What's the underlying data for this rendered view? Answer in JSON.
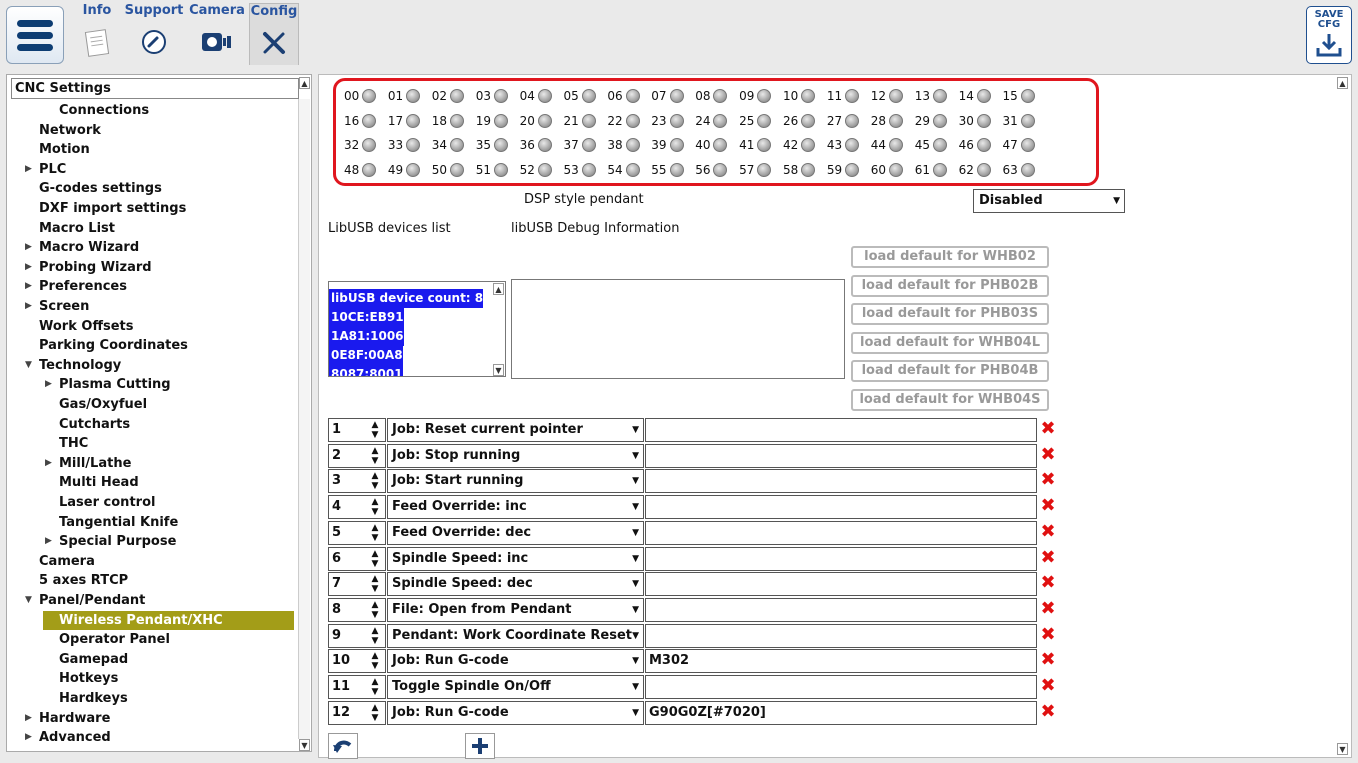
{
  "toolbar": {
    "tabs": [
      {
        "label": "Info",
        "icon": "info-panel-icon"
      },
      {
        "label": "Support",
        "icon": "phone-icon"
      },
      {
        "label": "Camera",
        "icon": "camera-icon"
      },
      {
        "label": "Config",
        "icon": "tools-icon"
      }
    ],
    "save_line1": "SAVE",
    "save_line2": "CFG"
  },
  "tree": {
    "title": "CNC Settings",
    "items": [
      {
        "label": "Connections"
      },
      {
        "label": "Network"
      },
      {
        "label": "Motion"
      },
      {
        "label": "PLC"
      },
      {
        "label": "G-codes settings"
      },
      {
        "label": "DXF import settings"
      },
      {
        "label": "Macro List"
      },
      {
        "label": "Macro Wizard"
      },
      {
        "label": "Probing Wizard"
      },
      {
        "label": "Preferences"
      },
      {
        "label": "Screen"
      },
      {
        "label": "Work Offsets"
      },
      {
        "label": "Parking Coordinates"
      },
      {
        "label": "Technology"
      },
      {
        "label": "Plasma Cutting"
      },
      {
        "label": "Gas/Oxyfuel"
      },
      {
        "label": "Cutcharts"
      },
      {
        "label": "THC"
      },
      {
        "label": "Mill/Lathe"
      },
      {
        "label": "Multi Head"
      },
      {
        "label": "Laser control"
      },
      {
        "label": "Tangential Knife"
      },
      {
        "label": "Special Purpose"
      },
      {
        "label": "Camera"
      },
      {
        "label": "5 axes RTCP"
      },
      {
        "label": "Panel/Pendant"
      },
      {
        "label": "Wireless Pendant/XHC"
      },
      {
        "label": "Operator Panel"
      },
      {
        "label": "Gamepad"
      },
      {
        "label": "Hotkeys"
      },
      {
        "label": "Hardkeys"
      },
      {
        "label": "Hardware"
      },
      {
        "label": "Advanced"
      }
    ]
  },
  "leds": [
    "00",
    "01",
    "02",
    "03",
    "04",
    "05",
    "06",
    "07",
    "08",
    "09",
    "10",
    "11",
    "12",
    "13",
    "14",
    "15",
    "16",
    "17",
    "18",
    "19",
    "20",
    "21",
    "22",
    "23",
    "24",
    "25",
    "26",
    "27",
    "28",
    "29",
    "30",
    "31",
    "32",
    "33",
    "34",
    "35",
    "36",
    "37",
    "38",
    "39",
    "40",
    "41",
    "42",
    "43",
    "44",
    "45",
    "46",
    "47",
    "48",
    "49",
    "50",
    "51",
    "52",
    "53",
    "54",
    "55",
    "56",
    "57",
    "58",
    "59",
    "60",
    "61",
    "62",
    "63"
  ],
  "dsp": {
    "label": "DSP style pendant",
    "value": "Disabled"
  },
  "libusb": {
    "devices_label": "LibUSB devices list",
    "debug_label": "libUSB Debug Information",
    "devices": [
      "libUSB device count: 8",
      "10CE:EB91",
      "1A81:1006",
      "0E8F:00A8",
      "8087:8001"
    ]
  },
  "load_buttons": [
    "load default for WHB02",
    "load default for PHB02B",
    "load default for PHB03S",
    "load default for WHB04L",
    "load default for PHB04B",
    "load default for WHB04S"
  ],
  "rows": [
    {
      "num": "1",
      "action": "Job: Reset current pointer",
      "param": ""
    },
    {
      "num": "2",
      "action": "Job: Stop running",
      "param": ""
    },
    {
      "num": "3",
      "action": "Job: Start running",
      "param": ""
    },
    {
      "num": "4",
      "action": "Feed Override: inc",
      "param": ""
    },
    {
      "num": "5",
      "action": "Feed Override: dec",
      "param": ""
    },
    {
      "num": "6",
      "action": "Spindle Speed: inc",
      "param": ""
    },
    {
      "num": "7",
      "action": "Spindle Speed: dec",
      "param": ""
    },
    {
      "num": "8",
      "action": "File: Open from Pendant",
      "param": ""
    },
    {
      "num": "9",
      "action": "Pendant: Work Coordinate Reset",
      "param": ""
    },
    {
      "num": "10",
      "action": "Job: Run G-code",
      "param": "M302"
    },
    {
      "num": "11",
      "action": "Toggle Spindle On/Off",
      "param": ""
    },
    {
      "num": "12",
      "action": "Job: Run G-code",
      "param": "G90G0Z[#7020]"
    }
  ],
  "colors": {
    "selection": "#a39d18",
    "led_border": "#e0161e",
    "device_highlight": "#1a1aee",
    "tab_text": "#2a55a0"
  }
}
